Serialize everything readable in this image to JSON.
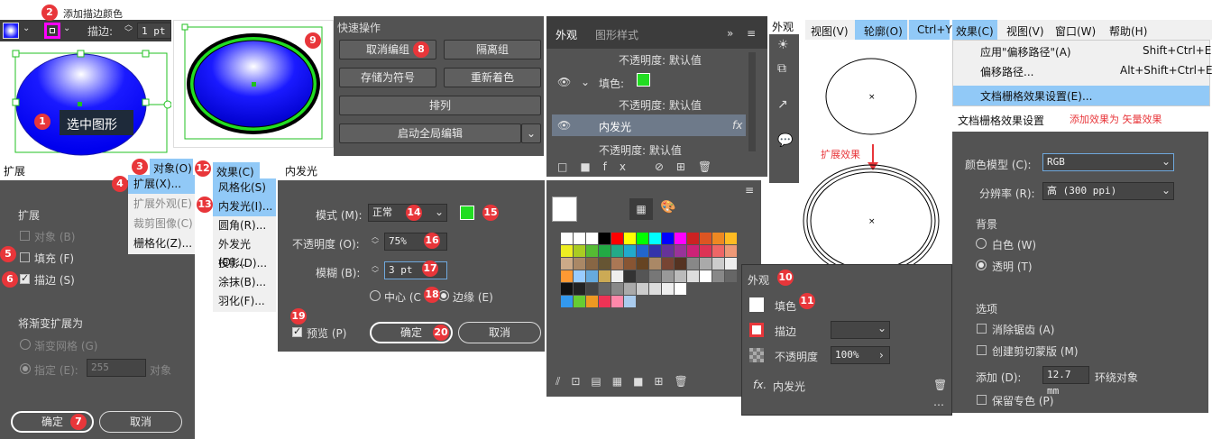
{
  "toolbar": {
    "stroke_label": "描边:",
    "stroke_value": "1 pt",
    "add_stroke_color_note": "添加描边颜色"
  },
  "canvas": {
    "selected_label": "选中图形"
  },
  "quick_actions": {
    "title": "快速操作",
    "ungroup": "取消编组",
    "isolate": "隔离组",
    "save_symbol": "存储为符号",
    "recolor": "重新着色",
    "arrange": "排列",
    "global_edit": "启动全局编辑"
  },
  "appearance_panel": {
    "tab_appearance": "外观",
    "tab_graphic_styles": "图形样式",
    "rows": [
      "不透明度: 默认值",
      "填色:",
      "不透明度: 默认值",
      "内发光",
      "不透明度: 默认值"
    ]
  },
  "side_tab": {
    "label": "外观"
  },
  "view_menu": {
    "items": [
      "视图(V)",
      "轮廓(O)",
      "Ctrl+Y"
    ],
    "expand_note": "扩展效果"
  },
  "effect_menu": {
    "bar": [
      "效果(C)",
      "视图(V)",
      "窗口(W)",
      "帮助(H)"
    ],
    "items": [
      {
        "label": "应用\"偏移路径\"(A)",
        "shortcut": "Shift+Ctrl+E"
      },
      {
        "label": "偏移路径...",
        "shortcut": "Alt+Shift+Ctrl+E"
      },
      {
        "label": "文档栅格效果设置(E)...",
        "shortcut": ""
      }
    ]
  },
  "raster_settings": {
    "title": "文档栅格效果设置",
    "note": "添加效果为 矢量效果",
    "color_model_label": "颜色模型 (C):",
    "color_model_value": "RGB",
    "resolution_label": "分辨率 (R):",
    "resolution_value": "高 (300 ppi)",
    "background_label": "背景",
    "bg_white": "白色 (W)",
    "bg_transparent": "透明 (T)",
    "options_label": "选项",
    "antialias": "消除锯齿 (A)",
    "clipping_mask": "创建剪切蒙版 (M)",
    "add_label": "添加 (D):",
    "add_value": "12.7 mm",
    "around_object": "环绕对象",
    "preserve_spot": "保留专色 (P)"
  },
  "expand_dialog": {
    "title": "扩展",
    "section_expand": "扩展",
    "object": "对象 (B)",
    "fill": "填充 (F)",
    "stroke": "描边 (S)",
    "gradient_label": "将渐变扩展为",
    "gradient_mesh": "渐变网格 (G)",
    "specify": "指定 (E):",
    "specify_value": "255",
    "objects": "对象",
    "ok": "确定",
    "cancel": "取消"
  },
  "object_menu": {
    "bar": "对象(O)",
    "items": [
      "扩展(X)...",
      "扩展外观(E)",
      "裁剪图像(C)",
      "栅格化(Z)..."
    ]
  },
  "effects_menu": {
    "bar": "效果(C)",
    "items": [
      "风格化(S)",
      "内发光(I)...",
      "圆角(R)...",
      "外发光(O)...",
      "投影(D)...",
      "涂抹(B)...",
      "羽化(F)..."
    ]
  },
  "inner_glow": {
    "title": "内发光",
    "mode_label": "模式 (M):",
    "mode_value": "正常",
    "opacity_label": "不透明度 (O):",
    "opacity_value": "75%",
    "blur_label": "模糊 (B):",
    "blur_value": "3 pt",
    "center": "中心 (C",
    "edge": "边缘 (E)",
    "preview": "预览 (P)",
    "ok": "确定",
    "cancel": "取消"
  },
  "appearance_float": {
    "title": "外观",
    "fill": "填色",
    "stroke": "描边",
    "opacity": "不透明度",
    "opacity_value": "100%",
    "inner_glow": "内发光"
  },
  "tags": [
    "1",
    "2",
    "3",
    "4",
    "5",
    "6",
    "7",
    "8",
    "9",
    "10",
    "11",
    "12",
    "13",
    "14",
    "15",
    "16",
    "17",
    "18",
    "19",
    "20"
  ],
  "colors": {
    "accent_red": "#e8363a",
    "glow_green": "#22dd22",
    "fill_blue": "#1a1aff",
    "menu_highlight": "#91c9f7"
  }
}
